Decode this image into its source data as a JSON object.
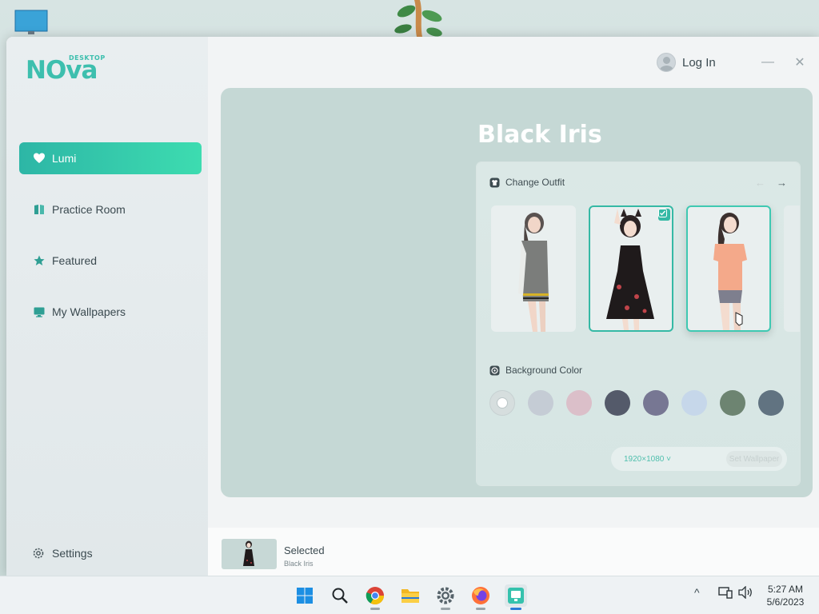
{
  "app": {
    "logo_text": "NOva",
    "logo_subtext": "DESKTOP",
    "login_label": "Log In",
    "minimize_glyph": "—",
    "close_glyph": "✕"
  },
  "sidebar": {
    "items": [
      {
        "label": "Lumi",
        "icon": "heart-icon",
        "active": true
      },
      {
        "label": "Practice Room",
        "icon": "book-icon",
        "active": false
      },
      {
        "label": "Featured",
        "icon": "star-icon",
        "active": false
      },
      {
        "label": "My Wallpapers",
        "icon": "monitor-icon",
        "active": false
      }
    ],
    "settings_label": "Settings"
  },
  "main": {
    "title": "Black Iris",
    "outfit_section": {
      "label": "Change Outfit",
      "prev_glyph": "←",
      "next_glyph": "→",
      "outfits": [
        {
          "name": "grey hoodie outfit",
          "selected": false
        },
        {
          "name": "black floral dress",
          "selected": true
        },
        {
          "name": "peach t-shirt outfit",
          "selected": false
        }
      ]
    },
    "background_section": {
      "label": "Background Color",
      "colors": [
        "#d6dede",
        "#c5ccd5",
        "#dbbfc9",
        "#545a6a",
        "#777793",
        "#c6d7ea",
        "#6d8471",
        "#617381"
      ],
      "selected_index": 0
    },
    "resolution": "1920×1080",
    "apply_label": "Set Wallpaper"
  },
  "footer": {
    "selected_label": "Selected",
    "selected_name": "Black Iris"
  },
  "taskbar": {
    "apps": [
      "windows-start-icon",
      "search-icon",
      "chrome-icon",
      "file-explorer-icon",
      "settings-icon",
      "firefox-icon",
      "nova-desktop-icon"
    ],
    "time": "5:27 AM",
    "date": "5/6/2023",
    "tray_chevron": "^"
  }
}
